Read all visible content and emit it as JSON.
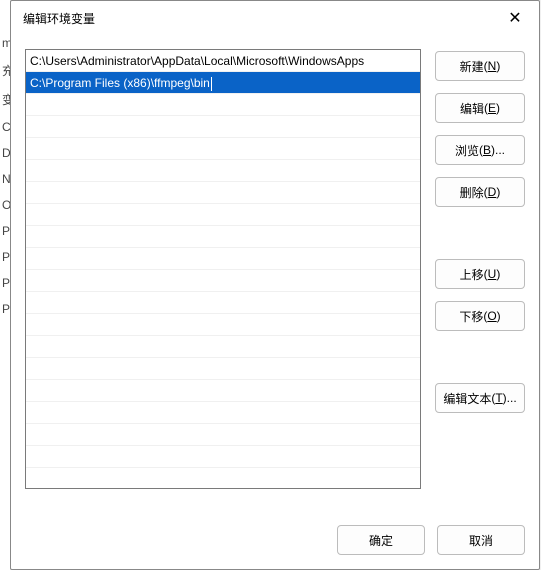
{
  "background_labels": [
    "m",
    "充",
    "变",
    "C",
    "D",
    "N",
    "O",
    "P",
    "P",
    "P",
    "P"
  ],
  "dialog": {
    "title": "编辑环境变量",
    "close_glyph": "✕"
  },
  "list": {
    "rows": [
      {
        "text": "C:\\Users\\Administrator\\AppData\\Local\\Microsoft\\WindowsApps",
        "selected": false
      },
      {
        "text": "C:\\Program Files (x86)\\ffmpeg\\bin",
        "selected": true
      }
    ],
    "empty_row_count": 18
  },
  "buttons": {
    "new": {
      "label": "新建",
      "mnemonic": "N"
    },
    "edit": {
      "label": "编辑",
      "mnemonic": "E"
    },
    "browse": {
      "label": "浏览",
      "mnemonic": "B",
      "suffix": "..."
    },
    "delete": {
      "label": "删除",
      "mnemonic": "D"
    },
    "moveup": {
      "label": "上移",
      "mnemonic": "U"
    },
    "movedown": {
      "label": "下移",
      "mnemonic": "O"
    },
    "edittext": {
      "label": "编辑文本",
      "mnemonic": "T",
      "suffix": "..."
    }
  },
  "footer": {
    "ok": "确定",
    "cancel": "取消"
  }
}
